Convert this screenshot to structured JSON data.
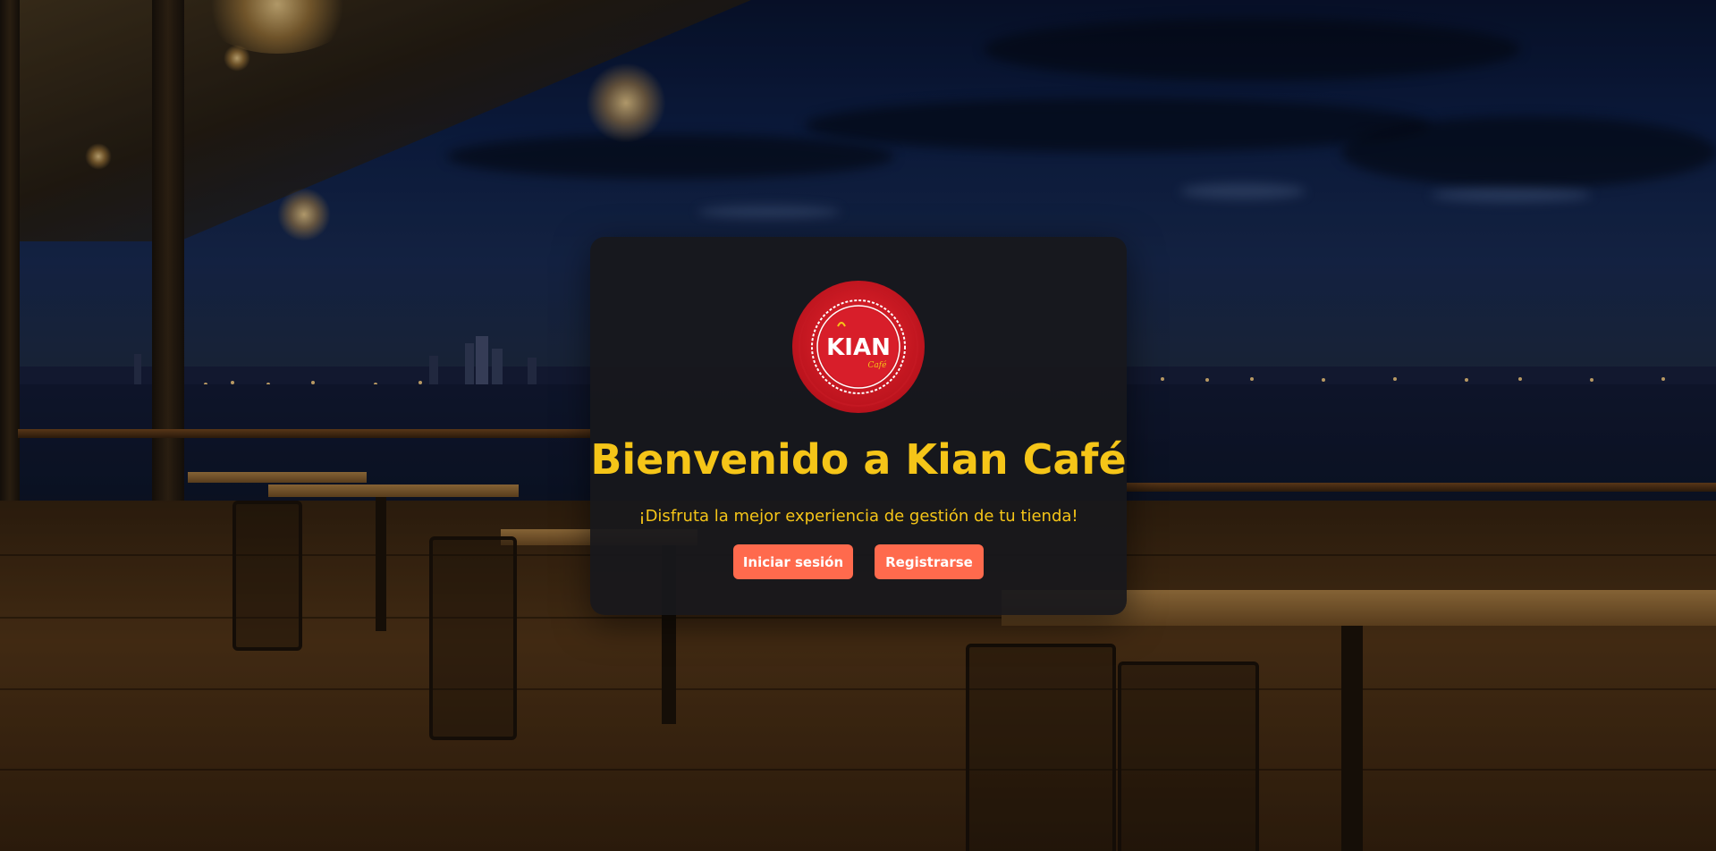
{
  "welcome": {
    "title": "Bienvenido a Kian Café",
    "subtitle": "¡Disfruta la mejor experiencia de gestión de tu tienda!",
    "logo": {
      "main_text": "KIAN",
      "sub_text": "Café",
      "brand_color": "#d81e2a"
    },
    "buttons": {
      "login_label": "Iniciar sesión",
      "register_label": "Registrarse"
    }
  },
  "colors": {
    "title": "#f5c518",
    "button": "#ff6a4d",
    "card": "#18181c"
  }
}
